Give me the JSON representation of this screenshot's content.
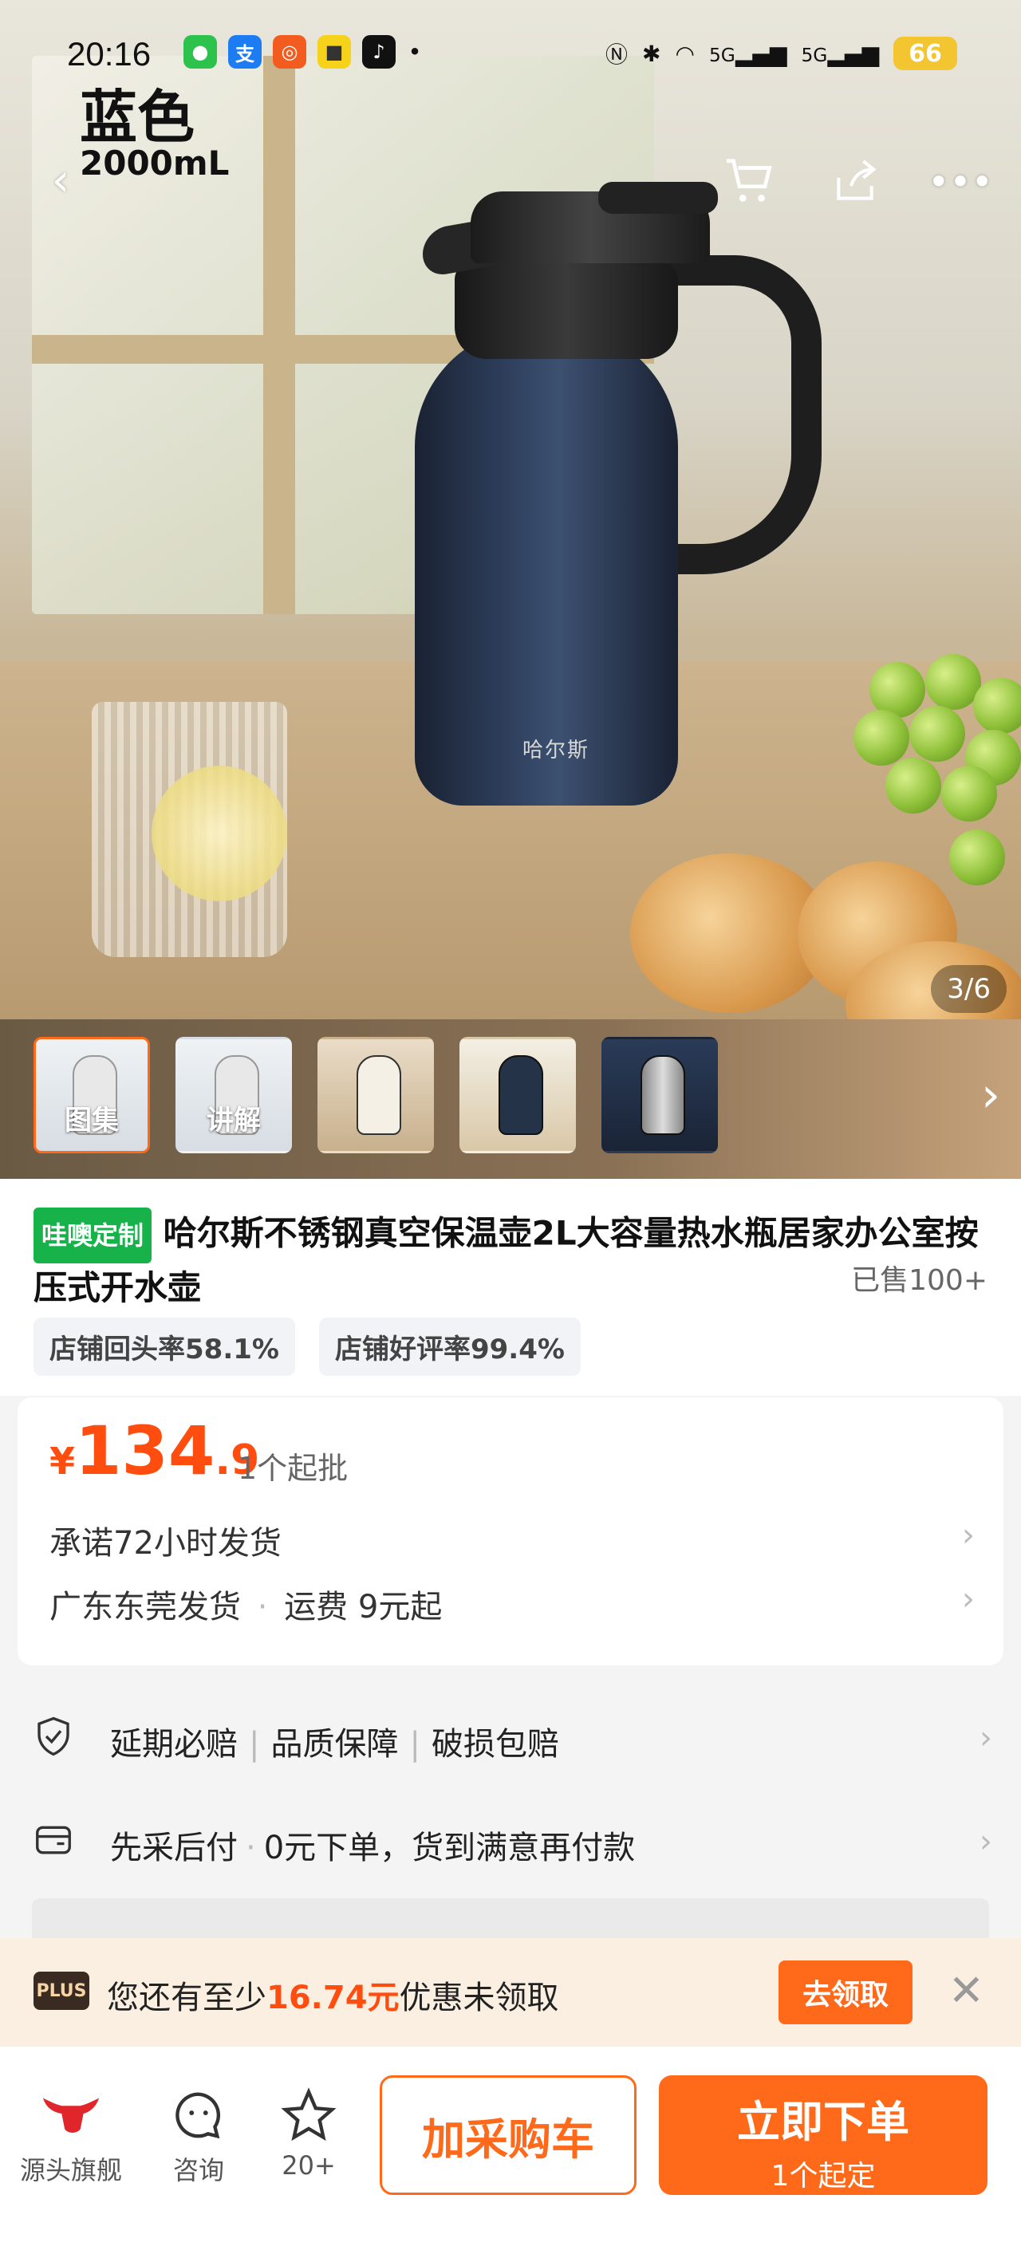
{
  "status_bar": {
    "time": "20:16",
    "battery": "66",
    "signal_labels": [
      "5G",
      "5G"
    ]
  },
  "hero": {
    "variant_color": "蓝色",
    "variant_size": "2000mL",
    "pot_brand": "哈尔斯",
    "image_counter": "3/6"
  },
  "thumbnails": [
    {
      "caption": "图集"
    },
    {
      "caption": "讲解"
    },
    {
      "caption": ""
    },
    {
      "caption": ""
    },
    {
      "caption": ""
    }
  ],
  "product": {
    "tag": "哇噢定制",
    "title": "哈尔斯不锈钢真空保温壶2L大容量热水瓶居家办公室按压式开水壶",
    "sold": "已售100+",
    "stats": [
      "店铺回头率58.1%",
      "店铺好评率99.4%"
    ]
  },
  "price": {
    "symbol": "¥",
    "integer": "134",
    "decimal": ".9",
    "min_order": "1个起批",
    "shipping_promise": "承诺72小时发货",
    "ship_from": "广东东莞发货",
    "shipping_fee": "运费 9元起"
  },
  "services": {
    "guarantees": [
      "延期必赔",
      "品质保障",
      "破损包赔"
    ],
    "pay_later": "先采后付",
    "pay_later_desc": "0元下单，货到满意再付款"
  },
  "promo": {
    "badge": "PLUS",
    "prefix": "您还有至少",
    "amount": "16.74元",
    "suffix": "优惠未领取",
    "claim_label": "去领取"
  },
  "bottom_bar": {
    "store_label": "源头旗舰",
    "consult_label": "咨询",
    "favorite_label": "20+",
    "cart_label": "加采购车",
    "buy_label": "立即下单",
    "buy_sub": "1个起定"
  },
  "colors": {
    "accent": "#ff6a1a",
    "price": "#ff4d0f",
    "tag_green": "#18b24b"
  }
}
